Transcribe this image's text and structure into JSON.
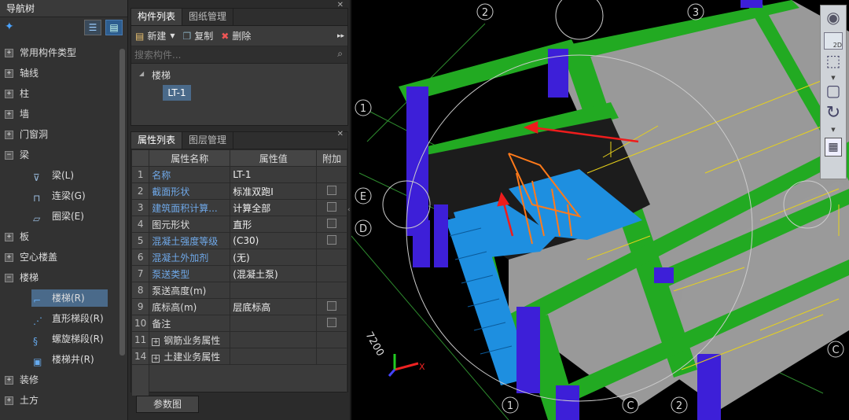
{
  "nav": {
    "title": "导航树",
    "items": [
      {
        "label": "常用构件类型",
        "expander": "+"
      },
      {
        "label": "轴线",
        "expander": "+"
      },
      {
        "label": "柱",
        "expander": "+"
      },
      {
        "label": "墙",
        "expander": "+"
      },
      {
        "label": "门窗洞",
        "expander": "+"
      },
      {
        "label": "梁",
        "expander": "−"
      },
      {
        "label": "板",
        "expander": "+"
      },
      {
        "label": "空心楼盖",
        "expander": "+"
      },
      {
        "label": "楼梯",
        "expander": "−"
      },
      {
        "label": "装修",
        "expander": "+"
      },
      {
        "label": "土方",
        "expander": "+"
      }
    ],
    "beam_children": [
      "梁(L)",
      "连梁(G)",
      "圈梁(E)"
    ],
    "stair_children": [
      "楼梯(R)",
      "直形梯段(R)",
      "螺旋梯段(R)",
      "楼梯井(R)"
    ]
  },
  "components": {
    "tabs": [
      "构件列表",
      "图纸管理"
    ],
    "toolbar": {
      "new": "新建",
      "copy": "复制",
      "delete": "删除"
    },
    "search_placeholder": "搜索构件...",
    "tree_root": "楼梯",
    "tree_item": "LT-1"
  },
  "properties": {
    "tabs": [
      "属性列表",
      "图层管理"
    ],
    "headers": [
      "属性名称",
      "属性值",
      "附加"
    ],
    "rows": [
      {
        "n": "1",
        "name": "名称",
        "value": "LT-1",
        "blue": true,
        "chk": false,
        "exp": ""
      },
      {
        "n": "2",
        "name": "截面形状",
        "value": "标准双跑I",
        "blue": true,
        "chk": true,
        "exp": ""
      },
      {
        "n": "3",
        "name": "建筑面积计算...",
        "value": "计算全部",
        "blue": true,
        "chk": true,
        "exp": ""
      },
      {
        "n": "4",
        "name": "图元形状",
        "value": "直形",
        "blue": false,
        "chk": true,
        "exp": ""
      },
      {
        "n": "5",
        "name": "混凝土强度等级",
        "value": "(C30)",
        "blue": true,
        "chk": true,
        "exp": ""
      },
      {
        "n": "6",
        "name": "混凝土外加剂",
        "value": "(无)",
        "blue": true,
        "chk": false,
        "exp": ""
      },
      {
        "n": "7",
        "name": "泵送类型",
        "value": "(混凝土泵)",
        "blue": true,
        "chk": false,
        "exp": ""
      },
      {
        "n": "8",
        "name": "泵送高度(m)",
        "value": "",
        "blue": false,
        "chk": false,
        "exp": ""
      },
      {
        "n": "9",
        "name": "底标高(m)",
        "value": "层底标高",
        "blue": false,
        "chk": true,
        "exp": ""
      },
      {
        "n": "10",
        "name": "备注",
        "value": "",
        "blue": false,
        "chk": true,
        "exp": ""
      },
      {
        "n": "11",
        "name": "钢筋业务属性",
        "value": "",
        "blue": false,
        "chk": false,
        "exp": "+"
      },
      {
        "n": "14",
        "name": "土建业务属性",
        "value": "",
        "blue": false,
        "chk": false,
        "exp": "+"
      }
    ],
    "param_button": "参数图"
  },
  "viewport": {
    "axis_labels": [
      "2",
      "3",
      "1",
      "E",
      "D",
      "C",
      "1",
      "C",
      "2"
    ],
    "dimension": "7200",
    "view_mode": "2D",
    "axis_x": "X"
  }
}
